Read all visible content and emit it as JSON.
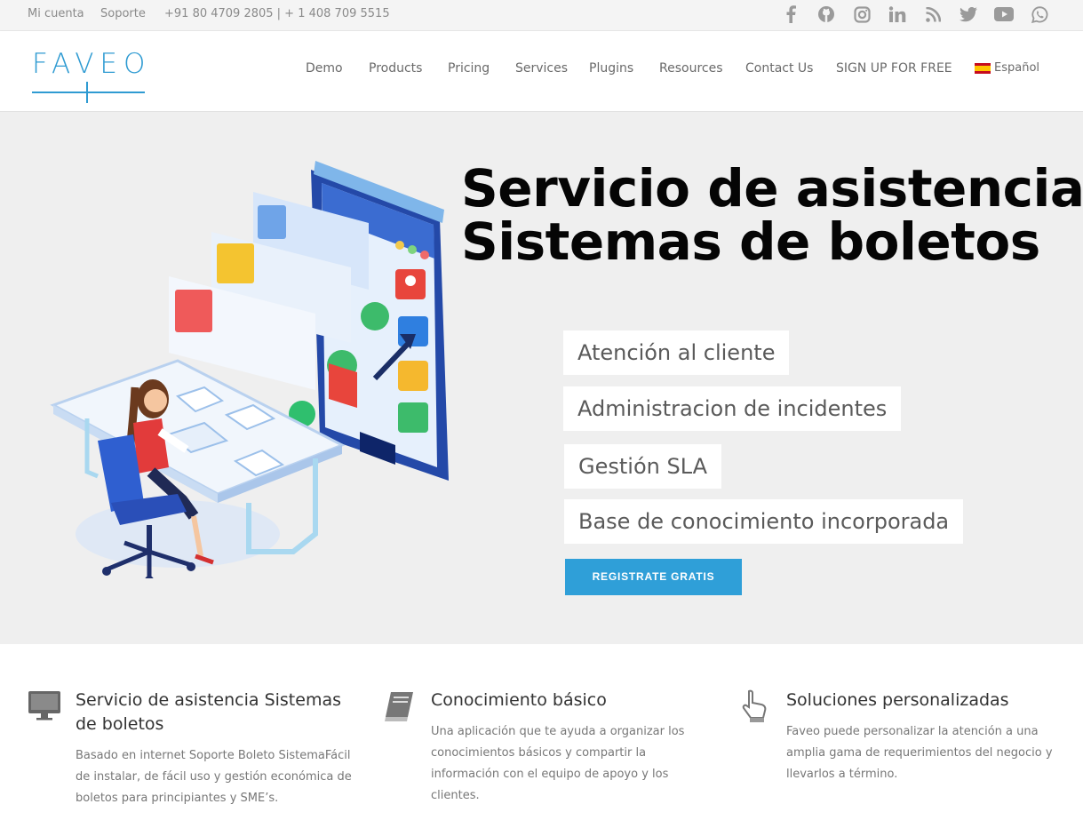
{
  "topbar": {
    "account": "Mi cuenta",
    "support": "Soporte",
    "phones": "+91 80 4709 2805 | + 1 408 709 5515",
    "social": [
      "facebook-icon",
      "github-icon",
      "instagram-icon",
      "linkedin-icon",
      "rss-icon",
      "twitter-icon",
      "youtube-icon",
      "whatsapp-icon"
    ]
  },
  "header": {
    "logo": "FAVEO",
    "nav": [
      "Demo",
      "Products",
      "Pricing",
      "Services",
      "Plugins",
      "Resources",
      "Contact Us",
      "SIGN UP FOR FREE"
    ],
    "language": "Español"
  },
  "hero": {
    "title_line1": "Servicio de asistencia",
    "title_line2": "Sistemas de boletos",
    "features": [
      "Atención al cliente",
      "Administracion de incidentes",
      "Gestión SLA",
      "Base de conocimiento incorporada"
    ],
    "cta": "REGISTRATE GRATIS"
  },
  "features": [
    {
      "icon": "monitor-icon",
      "title": "Servicio de asistencia Sistemas de boletos",
      "text": "Basado en internet Soporte Boleto SistemaFácil de instalar, de fácil uso y  gestión económica de boletos para principiantes y SME’s."
    },
    {
      "icon": "book-icon",
      "title": "Conocimiento básico",
      "text": "Una aplicación que te ayuda a organizar los conocimientos básicos y compartir la información con el equipo de apoyo y los clientes."
    },
    {
      "icon": "hand-pointer-icon",
      "title": "Soluciones personalizadas",
      "text": "Faveo puede personalizar la atención a una amplia gama de requerimientos del negocio y llevarlos a término."
    }
  ],
  "colors": {
    "brand": "#2f9bd2",
    "cta": "#2f9fd8",
    "hero_bg": "#efefef"
  }
}
